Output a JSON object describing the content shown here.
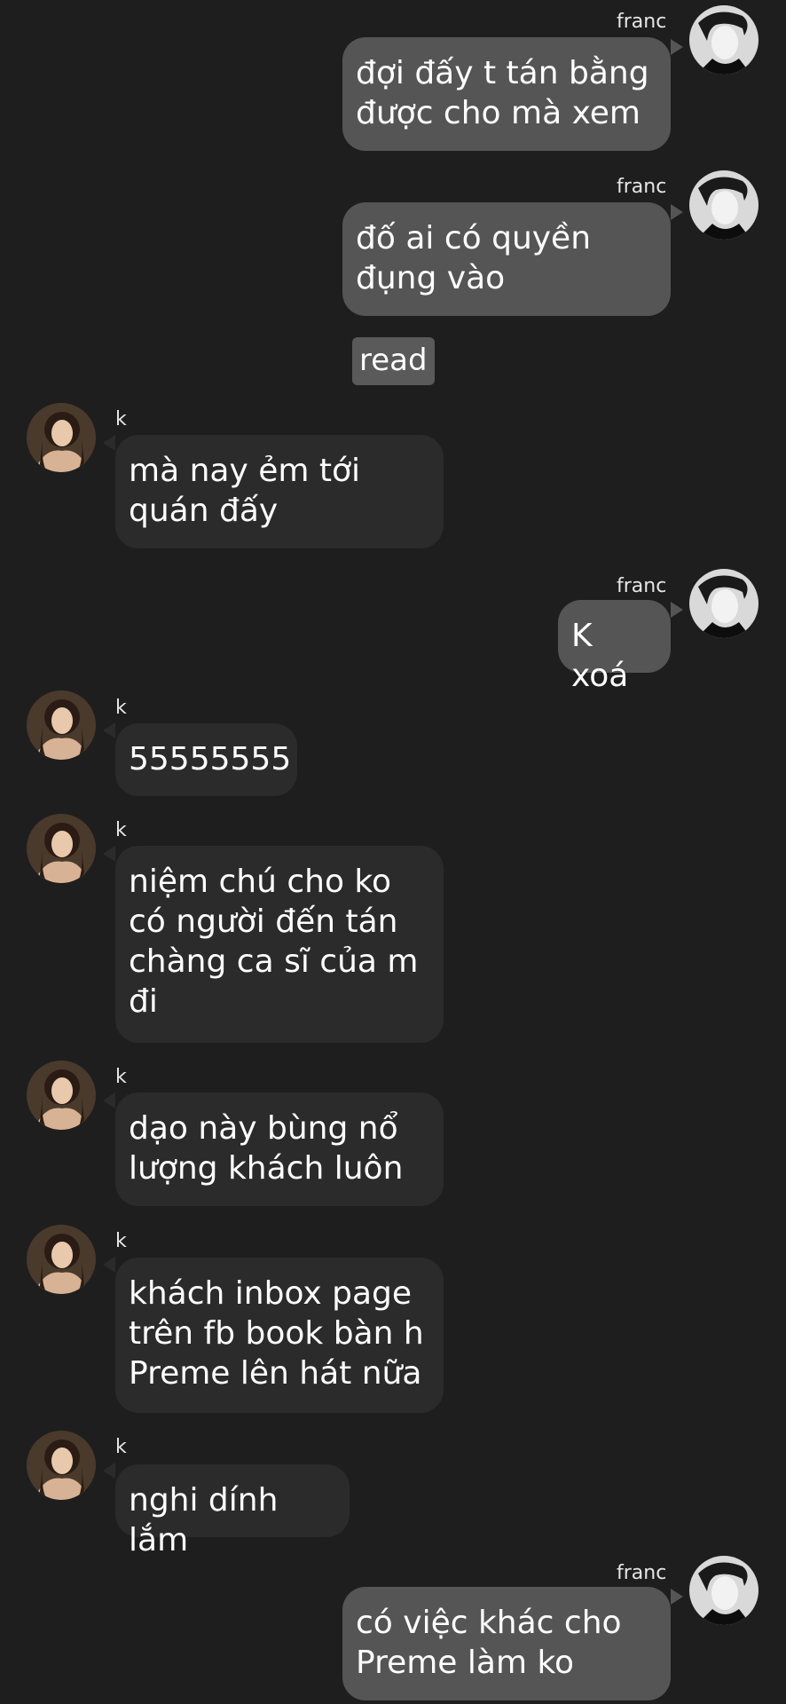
{
  "names": {
    "me": "franc",
    "them": "k"
  },
  "messages": [
    {
      "sender": "franc",
      "text": "đợi đấy t tán bằng\nđược cho mà xem"
    },
    {
      "sender": "franc",
      "text": "đố ai có quyền\nđụng vào"
    },
    {
      "status": "read"
    },
    {
      "sender": "k",
      "text": "mà nay ẻm tới\nquán đấy"
    },
    {
      "sender": "franc",
      "text": "K xoá"
    },
    {
      "sender": "k",
      "text": "55555555"
    },
    {
      "sender": "k",
      "text": "niệm chú cho ko\ncó người đến tán\nchàng ca sĩ của m\nđi"
    },
    {
      "sender": "k",
      "text": "dạo này bùng nổ\nlượng khách luôn"
    },
    {
      "sender": "k",
      "text": "khách inbox page\ntrên fb book bàn h\nPreme lên hát nữa"
    },
    {
      "sender": "k",
      "text": "nghi dính lắm"
    },
    {
      "sender": "franc",
      "text": "có việc khác cho\nPreme làm ko"
    }
  ],
  "colors": {
    "background": "#1e1e1e",
    "outgoing_bubble": "#555555",
    "incoming_bubble": "#2b2b2b",
    "read_badge": "#5a5a5a"
  }
}
